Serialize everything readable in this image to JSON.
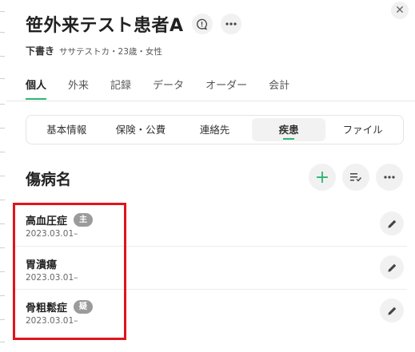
{
  "patient": {
    "name": "笹外来テスト患者A",
    "status": "下書き",
    "meta": "ササテストカ・23歳・女性"
  },
  "tabs": [
    "個人",
    "外来",
    "記録",
    "データ",
    "オーダー",
    "会計"
  ],
  "subtabs": [
    "基本情報",
    "保険・公費",
    "連絡先",
    "疾患",
    "ファイル"
  ],
  "section": {
    "title": "傷病名"
  },
  "diagnoses": [
    {
      "name": "高血圧症",
      "badge": "主",
      "date": "2023.03.01–"
    },
    {
      "name": "胃潰瘍",
      "badge": "",
      "date": "2023.03.01–"
    },
    {
      "name": "骨粗鬆症",
      "badge": "疑",
      "date": "2023.03.01–"
    }
  ],
  "colors": {
    "accent": "#2bb673",
    "badge": "#9b9b9b",
    "highlight": "#e0141b"
  },
  "icons": {
    "close": "close-icon",
    "chat": "speech-bubble-icon",
    "more": "more-horizontal-icon",
    "add": "plus-icon",
    "sort": "sort-list-icon",
    "edit": "pencil-icon"
  }
}
